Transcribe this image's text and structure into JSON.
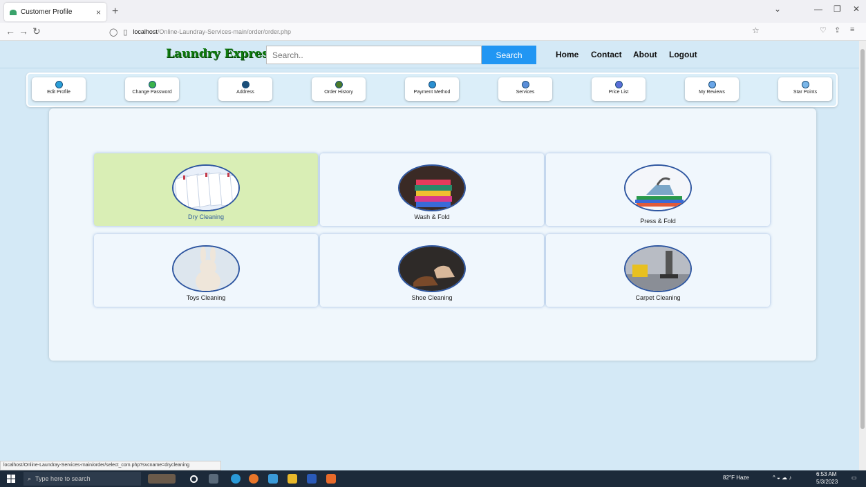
{
  "browser": {
    "tab_title": "Customer Profile",
    "url_host": "localhost",
    "url_path": "/Online-Laundray-Services-main/order/order.php",
    "status_url": "localhost/Online-Laundray-Services-main/order/select_com.php?svcname=drycleaning"
  },
  "header": {
    "brand": "Laundry Express",
    "search_placeholder": "Search..",
    "search_button": "Search",
    "nav": [
      "Home",
      "Contact",
      "About",
      "Logout"
    ]
  },
  "menu": {
    "items": [
      {
        "label": "Edit Profile",
        "icon": "user-icon",
        "color": "#2a9fd8"
      },
      {
        "label": "Change Password",
        "icon": "key-icon",
        "color": "#3ab24b"
      },
      {
        "label": "Address",
        "icon": "location-icon",
        "color": "#1b4f7a"
      },
      {
        "label": "Order History",
        "icon": "history-icon",
        "color": "#4a7a2a"
      },
      {
        "label": "Payment Method",
        "icon": "payment-icon",
        "color": "#2a8fd0"
      },
      {
        "label": "Services",
        "icon": "services-icon",
        "color": "#5a8ed8"
      },
      {
        "label": "Price List",
        "icon": "price-list-icon",
        "color": "#5a6ed8"
      },
      {
        "label": "My Reviews",
        "icon": "reviews-icon",
        "color": "#6aa6e8"
      },
      {
        "label": "Star Points",
        "icon": "star-icon",
        "color": "#7ab6e8"
      }
    ]
  },
  "services": [
    {
      "label": "Dry Cleaning",
      "icon": "dry-cleaning-icon",
      "active": true
    },
    {
      "label": "Wash & Fold",
      "icon": "wash-fold-icon",
      "active": false
    },
    {
      "label": "Press & Fold",
      "icon": "press-fold-icon",
      "active": false
    },
    {
      "label": "Toys Cleaning",
      "icon": "toys-cleaning-icon",
      "active": false
    },
    {
      "label": "Shoe Cleaning",
      "icon": "shoe-cleaning-icon",
      "active": false
    },
    {
      "label": "Carpet Cleaning",
      "icon": "carpet-cleaning-icon",
      "active": false
    }
  ],
  "taskbar": {
    "search_placeholder": "Type here to search",
    "weather": "82°F  Haze",
    "time": "6:53 AM",
    "date": "5/3/2023"
  }
}
